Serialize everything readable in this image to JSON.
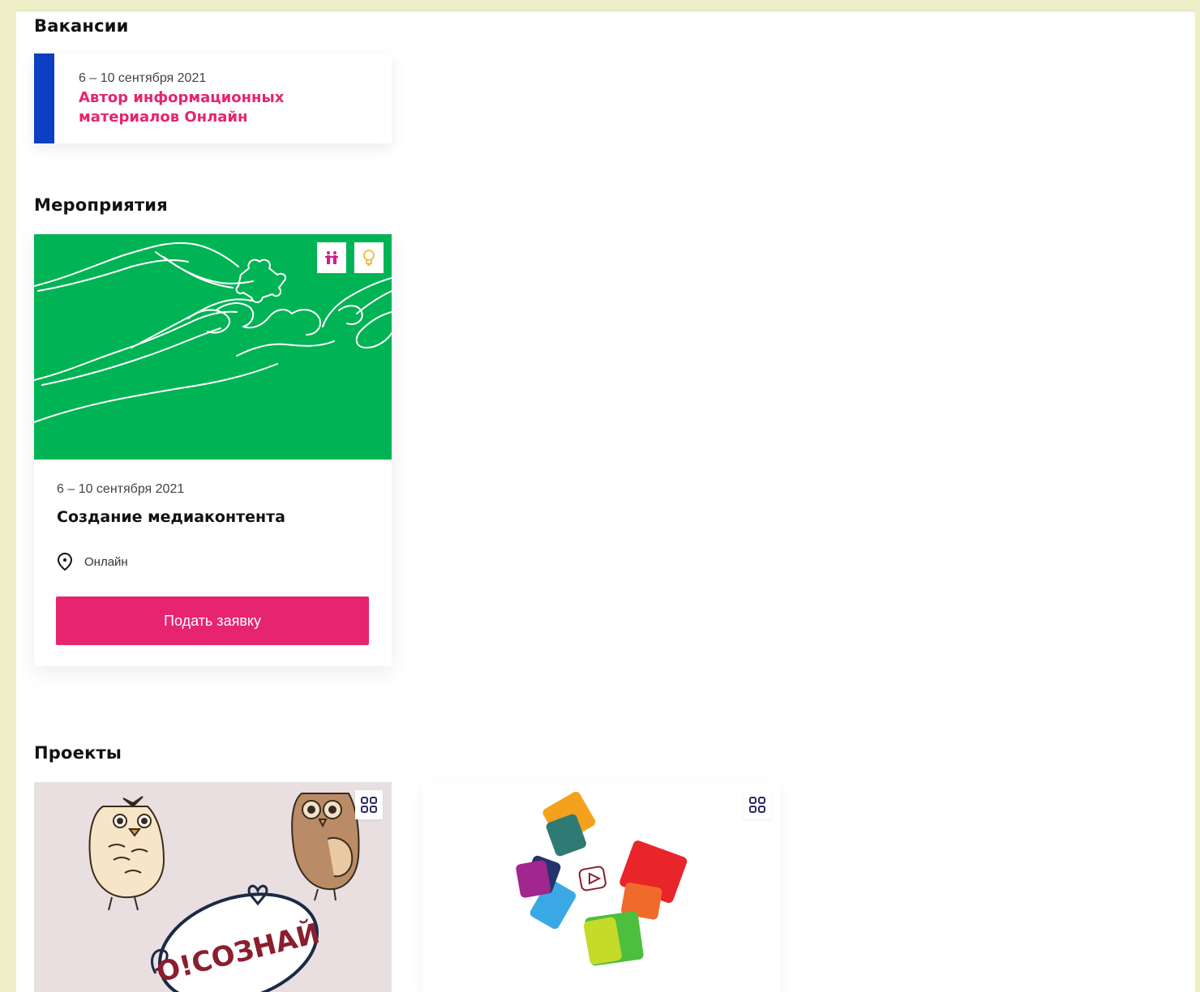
{
  "sections": {
    "vacancies_title": "Вакансии",
    "events_title": "Мероприятия",
    "projects_title": "Проекты"
  },
  "vacancy": {
    "date": "6 – 10 сентября 2021",
    "title": "Автор информационных материалов Онлайн",
    "accent_color": "#0d3fc4",
    "title_color": "#e6246f"
  },
  "event": {
    "date": "6 – 10 сентября 2021",
    "title": "Создание медиаконтента",
    "location": "Онлайн",
    "apply_label": "Подать заявку",
    "image_color": "#00b354",
    "badges": [
      "people-icon",
      "lightbulb-icon"
    ]
  },
  "projects": [
    {
      "logo_text": "O!СОЗНАЙ",
      "icon": "grid-icon"
    },
    {
      "icon": "grid-icon"
    }
  ]
}
